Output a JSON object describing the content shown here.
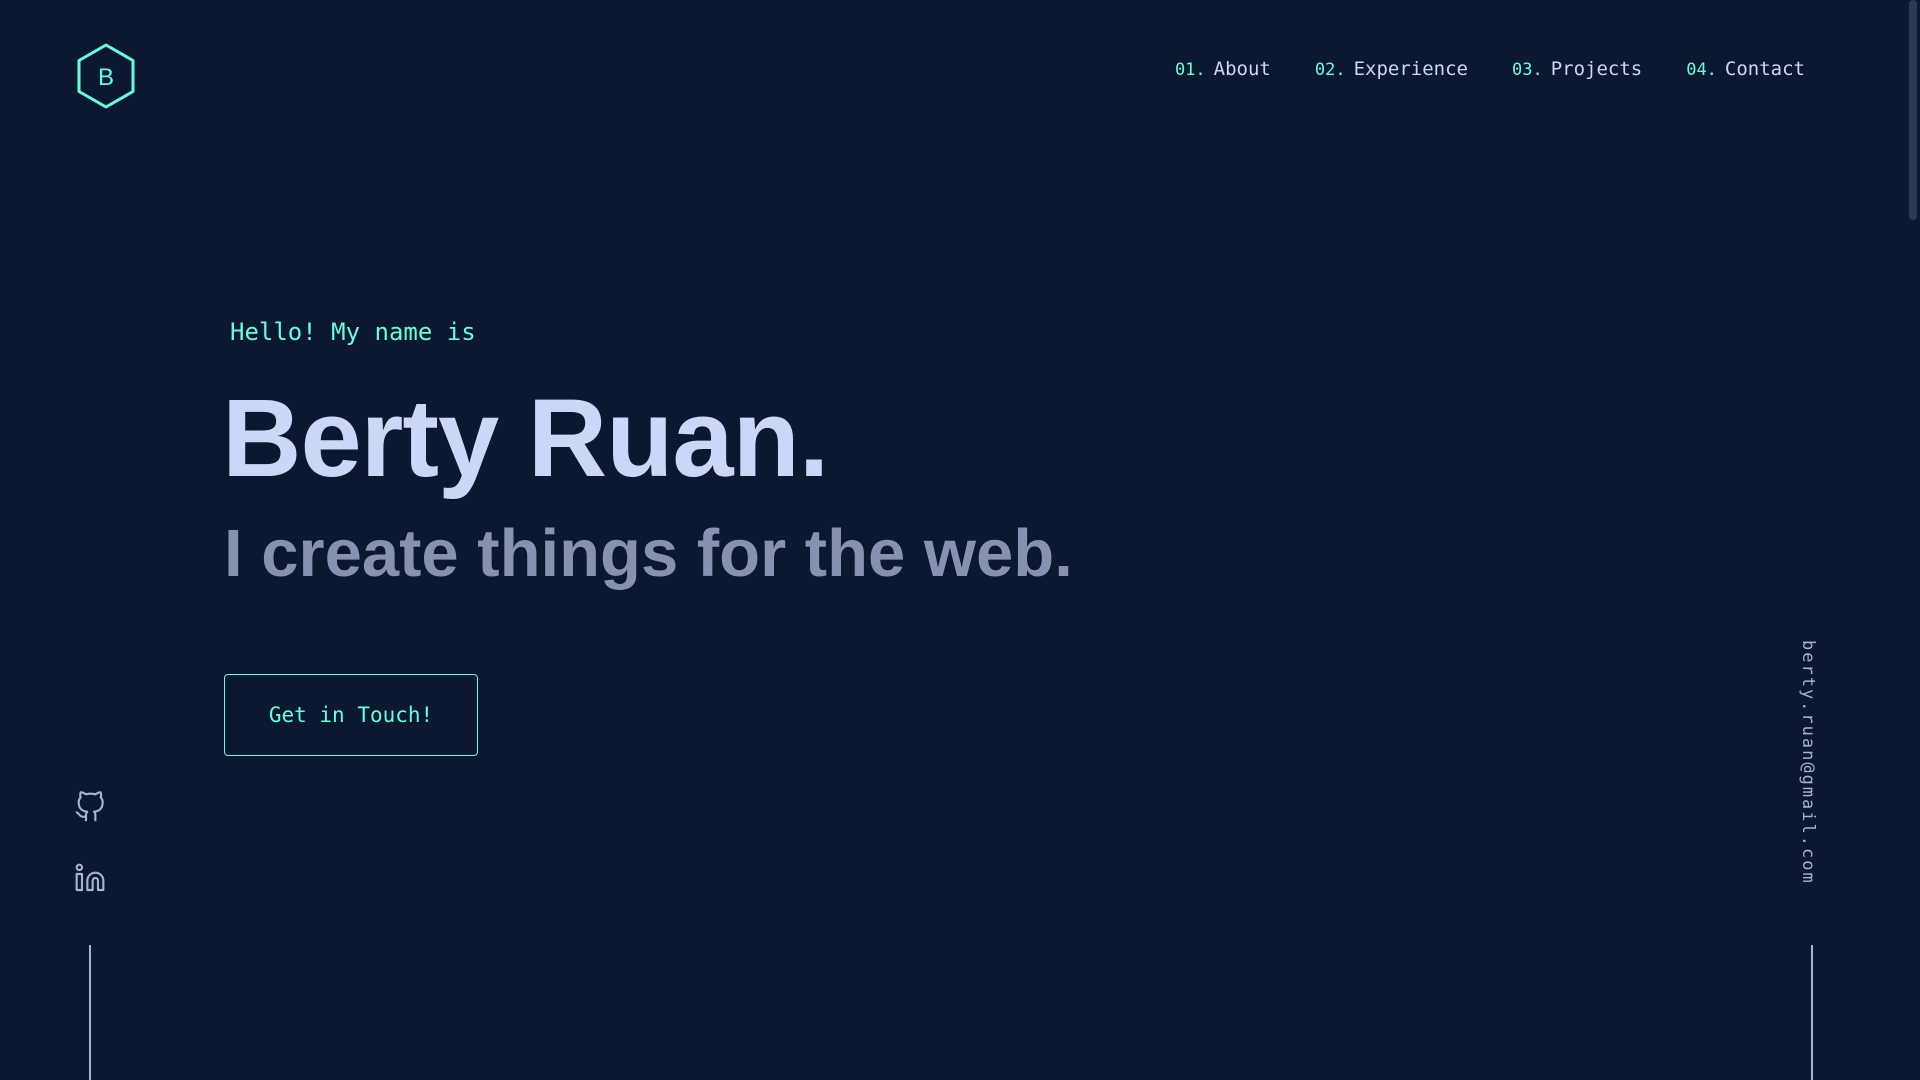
{
  "logo": {
    "letter": "B",
    "icon": "hexagon-logo-icon"
  },
  "nav": {
    "items": [
      {
        "num": "01.",
        "label": "About"
      },
      {
        "num": "02.",
        "label": "Experience"
      },
      {
        "num": "03.",
        "label": "Projects"
      },
      {
        "num": "04.",
        "label": "Contact"
      }
    ]
  },
  "hero": {
    "intro": "Hello! My name is",
    "name": "Berty Ruan.",
    "tagline": "I create things for the web.",
    "cta_label": "Get in Touch!"
  },
  "social": {
    "github_icon": "github-icon",
    "linkedin_icon": "linkedin-icon"
  },
  "email": "berty.ruan@gmail.com",
  "colors": {
    "background": "#0b182f",
    "accent": "#64ffda",
    "heading": "#ccd6f6",
    "muted": "#8892b0",
    "light": "#a8b2d1"
  }
}
